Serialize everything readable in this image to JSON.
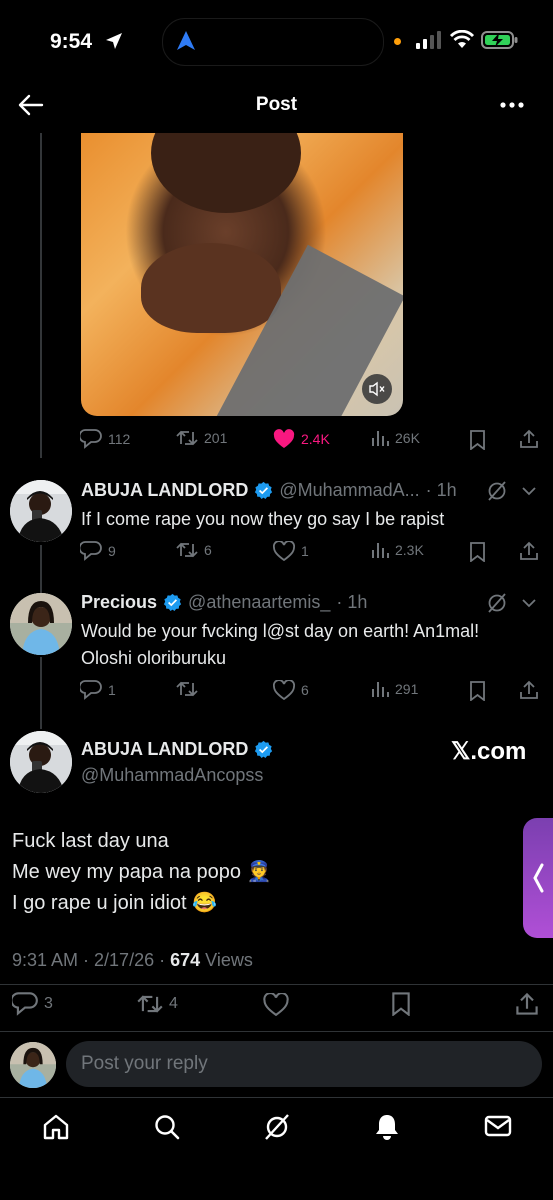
{
  "status": {
    "time": "9:54"
  },
  "header": {
    "title": "Post"
  },
  "main_post_actions": {
    "replies": "112",
    "reposts": "201",
    "likes": "2.4K",
    "views": "26K"
  },
  "replies": [
    {
      "name": "ABUJA LANDLORD",
      "handle": "@MuhammadA...",
      "time": "· 1h",
      "text": "If I come rape you now they go say I be rapist",
      "replies": "9",
      "reposts": "6",
      "likes": "1",
      "views": "2.3K"
    },
    {
      "name": "Precious",
      "handle": "@athenaartemis_",
      "time": "· 1h",
      "text_line1": "Would be your fvcking l@st day on earth! An1mal!",
      "text_line2": "Oloshi oloriburuku",
      "replies": "1",
      "reposts": "",
      "likes": "6",
      "views": "291"
    }
  ],
  "focused_post": {
    "name": "ABUJA LANDLORD",
    "handle": "@MuhammadAncopss",
    "watermark": "𝕏.com",
    "line1": "Fuck last day una",
    "line2": "Me wey my papa na popo 👮",
    "line3": "I go rape u join idiot 😂",
    "datetime": "9:31 AM · 2/17/26 · ",
    "views_count": "674",
    "views_label": " Views",
    "replies": "3",
    "reposts": "4"
  },
  "reply_box": {
    "placeholder": "Post your reply"
  },
  "icons": {
    "nav": [
      "home-icon",
      "search-icon",
      "grok-icon",
      "notifications-icon",
      "messages-icon"
    ]
  },
  "colors": {
    "like": "#f91880",
    "verified": "#1d9bf0",
    "muted": "#71767b"
  }
}
